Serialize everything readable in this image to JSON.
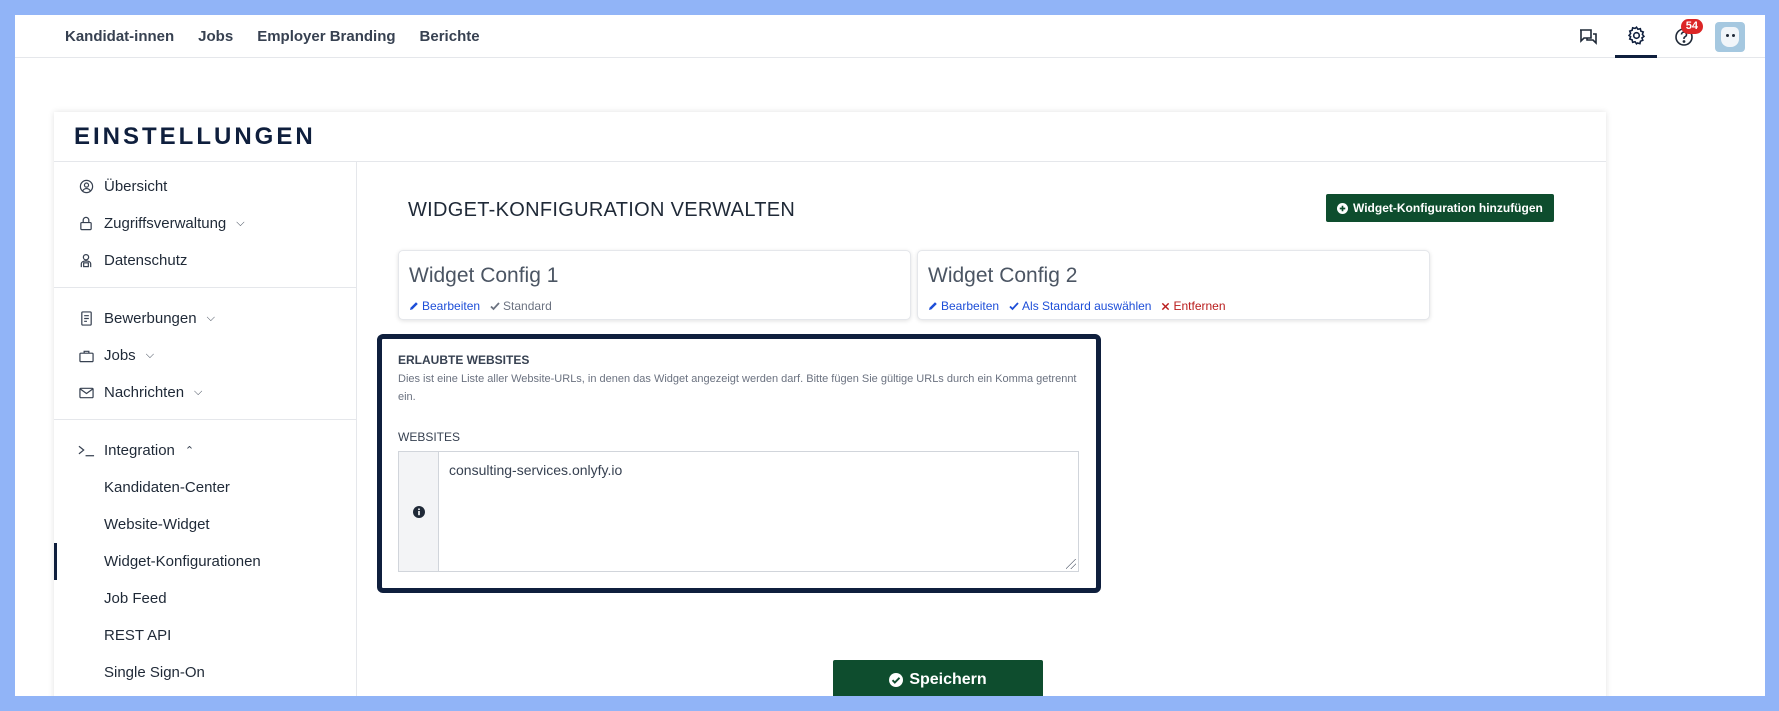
{
  "nav": {
    "links": [
      "Kandidat-innen",
      "Jobs",
      "Employer Branding",
      "Berichte"
    ],
    "notifications_count": "54"
  },
  "settings": {
    "title": "EINSTELLUNGEN"
  },
  "sidebar": {
    "overview": "Übersicht",
    "access": "Zugriffsverwaltung",
    "privacy": "Datenschutz",
    "applications": "Bewerbungen",
    "jobs": "Jobs",
    "messages": "Nachrichten",
    "integration": "Integration",
    "integration_items": [
      "Kandidaten-Center",
      "Website-Widget",
      "Widget-Konfigurationen",
      "Job Feed",
      "REST API",
      "Single Sign-On"
    ],
    "active_item": "Widget-Konfigurationen"
  },
  "main": {
    "title": "WIDGET-KONFIGURATION VERWALTEN",
    "add_button": "Widget-Konfiguration hinzufügen",
    "configs": [
      {
        "name": "Widget Config 1",
        "edit": "Bearbeiten",
        "status": "Standard"
      },
      {
        "name": "Widget Config 2",
        "edit": "Bearbeiten",
        "set_default": "Als Standard auswählen",
        "remove": "Entfernen"
      }
    ],
    "allowed": {
      "title": "ERLAUBTE WEBSITES",
      "description": "Dies ist eine Liste aller Website-URLs, in denen das Widget angezeigt werden darf. Bitte fügen Sie gültige URLs durch ein Komma getrennt ein.",
      "websites_label": "WEBSITES",
      "websites_value": "consulting-services.onlyfy.io"
    },
    "save_button": "Speichern"
  },
  "colors": {
    "background": "#91b4f7",
    "navy": "#0f1f3d",
    "primary_green": "#0e4d2e",
    "link_blue": "#1d4ed8",
    "danger_red": "#b91c1c",
    "badge_red": "#dc2626"
  }
}
